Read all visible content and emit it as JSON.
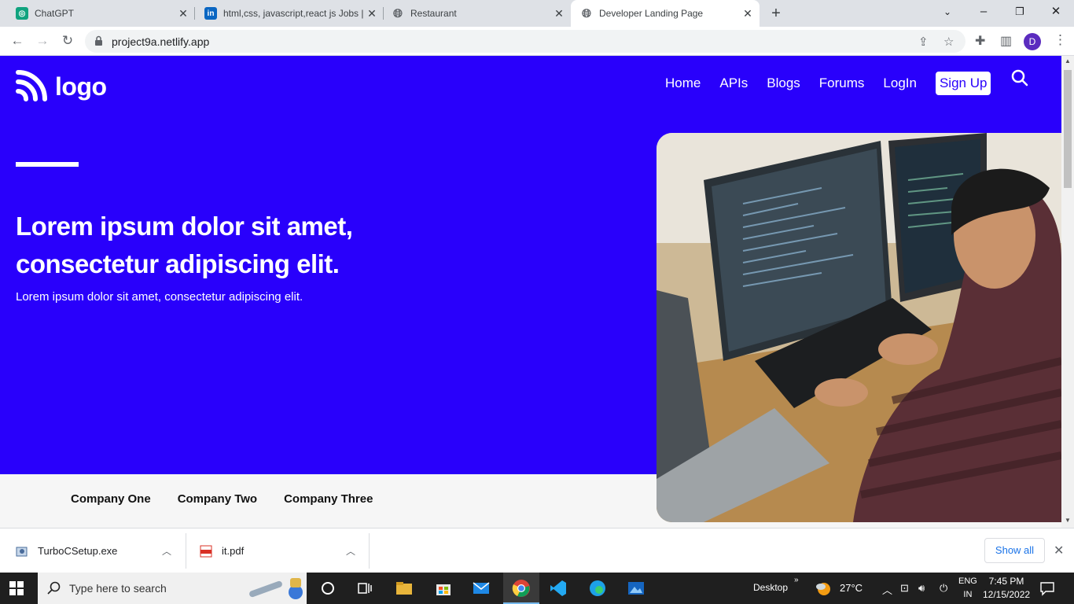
{
  "browser": {
    "tabs": [
      {
        "title": "ChatGPT",
        "favicon": "chatgpt-icon",
        "active": false
      },
      {
        "title": "html,css, javascript,react js Jobs |",
        "favicon": "linkedin-icon",
        "active": false
      },
      {
        "title": "Restaurant",
        "favicon": "globe-icon",
        "active": false
      },
      {
        "title": "Developer Landing Page",
        "favicon": "globe-icon",
        "active": true
      }
    ],
    "url": "project9a.netlify.app",
    "profile_initial": "D"
  },
  "site": {
    "logo_text": "logo",
    "nav": [
      "Home",
      "APIs",
      "Blogs",
      "Forums",
      "LogIn"
    ],
    "signup_label": "Sign Up",
    "headline": "Lorem ipsum dolor sit amet, consectetur adipiscing elit.",
    "subline": "Lorem ipsum dolor sit amet, consectetur adipiscing elit.",
    "companies": [
      "Company One",
      "Company Two",
      "Company Three"
    ],
    "hero_color": "#2900fb",
    "hero_image": "developer-at-computers-photo"
  },
  "downloads": {
    "items": [
      {
        "name": "TurboCSetup.exe",
        "icon": "installer-icon"
      },
      {
        "name": "it.pdf",
        "icon": "pdf-icon"
      }
    ],
    "show_all_label": "Show all"
  },
  "taskbar": {
    "search_placeholder": "Type here to search",
    "desktop_label": "Desktop",
    "temperature": "27°C",
    "lang_top": "ENG",
    "lang_bottom": "IN",
    "time": "7:45 PM",
    "date": "12/15/2022"
  }
}
